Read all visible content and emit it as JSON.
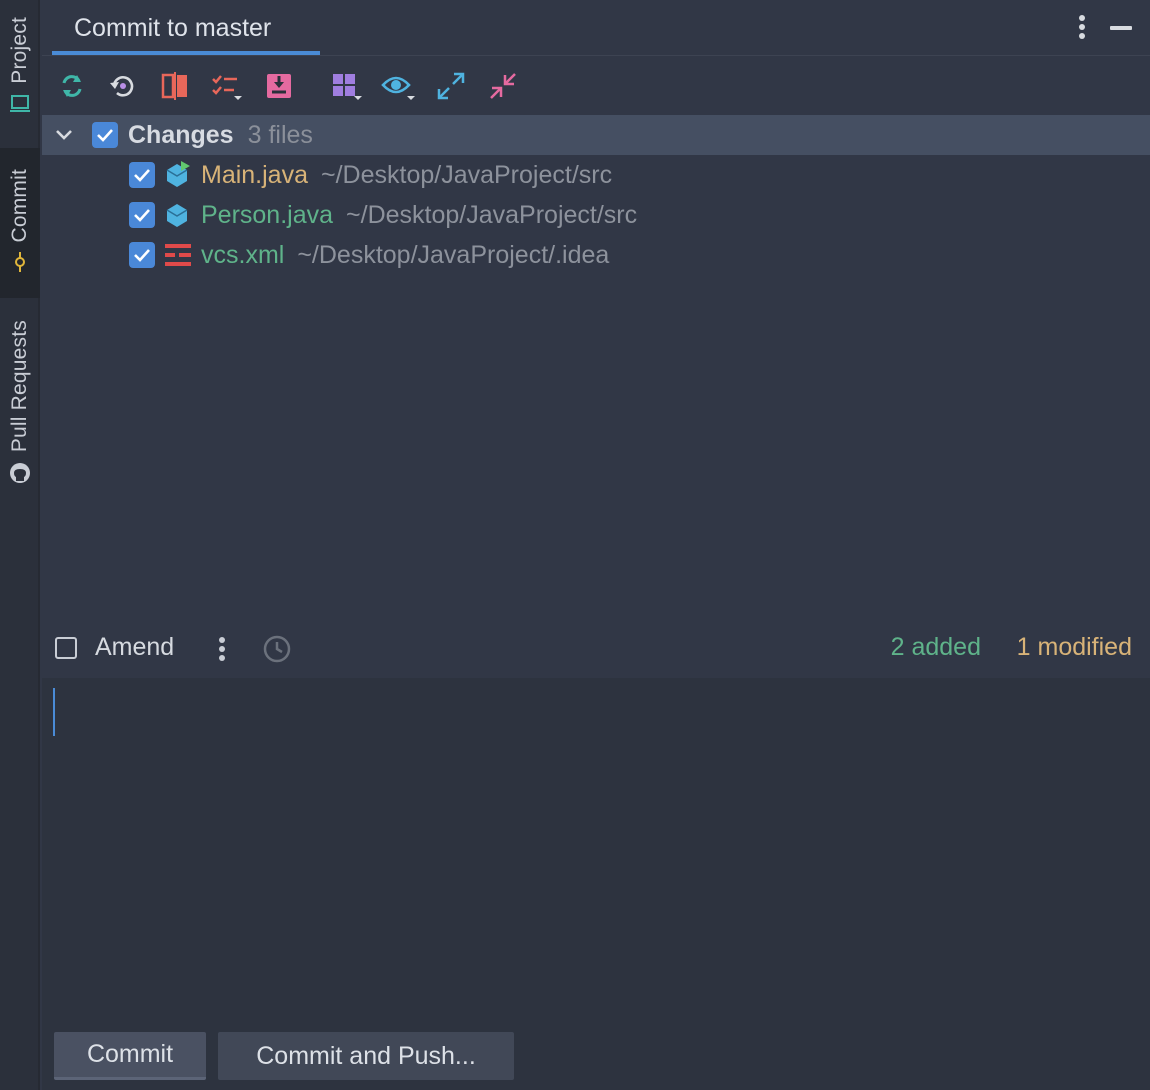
{
  "side_tabs": [
    {
      "label": "Project",
      "icon": "monitor-icon"
    },
    {
      "label": "Commit",
      "icon": "commit-icon"
    },
    {
      "label": "Pull Requests",
      "icon": "github-icon"
    }
  ],
  "header": {
    "title": "Commit to master"
  },
  "toolbar": {
    "icons": [
      "refresh-icon",
      "rollback-icon",
      "diff-icon",
      "changelist-icon",
      "shelve-icon",
      "group-by-icon",
      "view-options-icon",
      "expand-all-icon",
      "collapse-all-icon"
    ]
  },
  "changes": {
    "label": "Changes",
    "count": "3 files",
    "files": [
      {
        "name": "Main.java",
        "path": "~/Desktop/JavaProject/src",
        "color": "#d8b378",
        "icon": "java-class-run-icon"
      },
      {
        "name": "Person.java",
        "path": "~/Desktop/JavaProject/src",
        "color": "#5fb38a",
        "icon": "java-class-icon"
      },
      {
        "name": "vcs.xml",
        "path": "~/Desktop/JavaProject/.idea",
        "color": "#5fb38a",
        "icon": "xml-file-icon"
      }
    ]
  },
  "amend": {
    "label": "Amend",
    "checked": false
  },
  "stats": {
    "added": "2 added",
    "modified": "1 modified"
  },
  "message": {
    "value": ""
  },
  "buttons": {
    "commit": "Commit",
    "commit_and_push": "Commit and Push..."
  },
  "colors": {
    "accent": "#4a8bd6",
    "added": "#5fb38a",
    "modified": "#d8b378"
  }
}
